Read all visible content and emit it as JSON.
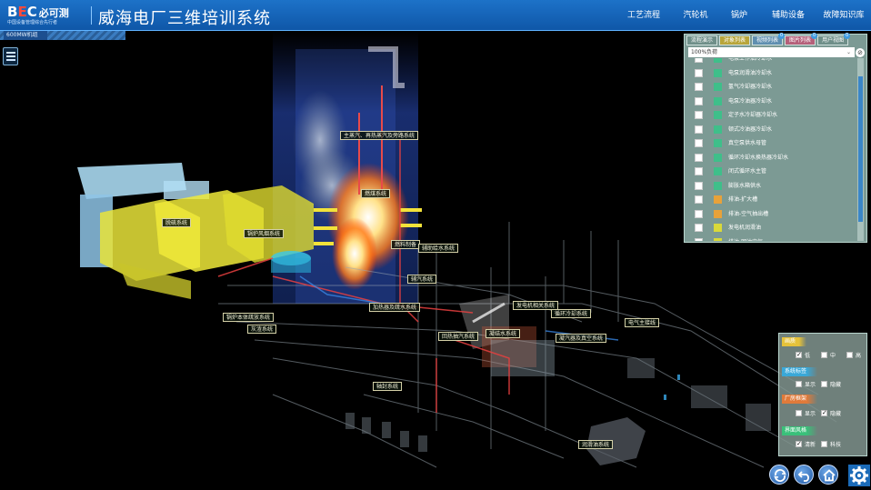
{
  "header": {
    "logo_text_a": "B",
    "logo_text_b": "E",
    "logo_text_c": "C",
    "logo_brand": "必可测",
    "logo_sub": "中国设备管理综合先行者",
    "title": "威海电厂三维培训系统",
    "nav": [
      "工艺流程",
      "汽轮机",
      "锅炉",
      "辅助设备",
      "故障知识库"
    ]
  },
  "unit_tag": "600MW机组",
  "scene_labels": [
    {
      "id": "main-steam",
      "text": "主蒸汽、再热蒸汽及旁路系统"
    },
    {
      "id": "burner",
      "text": "燃煤系统"
    },
    {
      "id": "desulfur",
      "text": "脱硫系统"
    },
    {
      "id": "flue-gas",
      "text": "锅炉风烟系统"
    },
    {
      "id": "fuel-prep",
      "text": "燃料制备"
    },
    {
      "id": "feedwater",
      "text": "辅助给水系统"
    },
    {
      "id": "aux-steam",
      "text": "辅汽系统"
    },
    {
      "id": "heater-drain",
      "text": "加热器及疏水系统"
    },
    {
      "id": "gen-aux",
      "text": "发电机相关系统"
    },
    {
      "id": "closed-cooling",
      "text": "循环冷却系统"
    },
    {
      "id": "boiler-drain",
      "text": "锅炉本体疏放系统"
    },
    {
      "id": "ash",
      "text": "灰渣系统"
    },
    {
      "id": "extraction",
      "text": "回热抽汽系统"
    },
    {
      "id": "condensate",
      "text": "凝结水系统"
    },
    {
      "id": "vacuum",
      "text": "凝汽器及真空系统"
    },
    {
      "id": "electrical",
      "text": "电气主接线"
    },
    {
      "id": "gland",
      "text": "轴封系统"
    },
    {
      "id": "lube",
      "text": "润滑油系统"
    }
  ],
  "panel": {
    "tabs": [
      {
        "label": "流程演示",
        "color": "#6f8f89",
        "badge": ""
      },
      {
        "label": "对象列表",
        "color": "#b8a53a",
        "badge": ""
      },
      {
        "label": "视频列表",
        "color": "#5f8fb0",
        "badge": "0"
      },
      {
        "label": "图片列表",
        "color": "#b5607a",
        "badge": "0"
      },
      {
        "label": "用户视图",
        "color": "#6f8f89",
        "badge": "0"
      }
    ],
    "select_value": "100%负荷",
    "items": [
      {
        "label": "电泵工作油冷却水",
        "color": "#3fbf8a"
      },
      {
        "label": "电泵润滑油冷却水",
        "color": "#3fbf8a"
      },
      {
        "label": "氢气冷却器冷却水",
        "color": "#3fbf8a"
      },
      {
        "label": "电泵冷油器冷却水",
        "color": "#3fbf8a"
      },
      {
        "label": "定子水冷却器冷却水",
        "color": "#3fbf8a"
      },
      {
        "label": "顿式冷油器冷却水",
        "color": "#3fbf8a"
      },
      {
        "label": "真空泵供水母管",
        "color": "#3fbf8a"
      },
      {
        "label": "循环冷却水换热器冷却水",
        "color": "#3fbf8a"
      },
      {
        "label": "闭式循环水主管",
        "color": "#3fbf8a"
      },
      {
        "label": "膨胀水箱供水",
        "color": "#3fbf8a"
      },
      {
        "label": "排油-扩大槽",
        "color": "#e8a23a"
      },
      {
        "label": "排油-空气抽出槽",
        "color": "#e8a23a"
      },
      {
        "label": "发电机润滑油",
        "color": "#d9d93a"
      },
      {
        "label": "排油-回油空气",
        "color": "#d9d93a"
      }
    ]
  },
  "settings": {
    "sections": [
      {
        "title": "画质",
        "color": "#e6c23a",
        "options": [
          {
            "label": "低",
            "on": true
          },
          {
            "label": "中",
            "on": false
          },
          {
            "label": "高",
            "on": false
          }
        ]
      },
      {
        "title": "系统标签",
        "color": "#3aa8d8",
        "options": [
          {
            "label": "显示",
            "on": false
          },
          {
            "label": "隐藏",
            "on": false
          }
        ]
      },
      {
        "title": "厂房框架",
        "color": "#e07a3a",
        "options": [
          {
            "label": "显示",
            "on": false
          },
          {
            "label": "隐藏",
            "on": true
          }
        ]
      },
      {
        "title": "界面风格",
        "color": "#3ac07a",
        "options": [
          {
            "label": "清新",
            "on": true
          },
          {
            "label": "科技",
            "on": false
          }
        ]
      }
    ]
  }
}
